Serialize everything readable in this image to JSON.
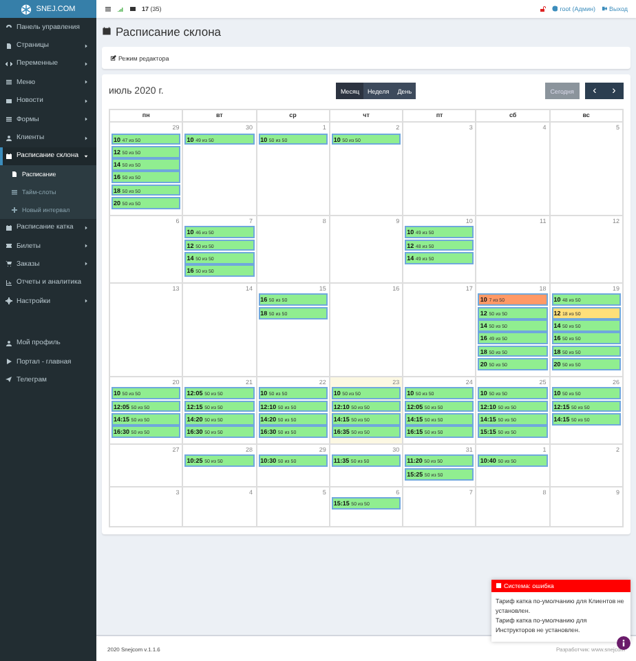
{
  "brand": "SNEJ.COM",
  "sidebar": {
    "items": [
      {
        "label": "Панель управления",
        "has_caret": false,
        "selected": false
      },
      {
        "label": "Страницы",
        "has_caret": true,
        "expanded": false,
        "selected": false
      },
      {
        "label": "Переменные",
        "has_caret": true,
        "expanded": false,
        "selected": false
      },
      {
        "label": "Меню",
        "has_caret": true,
        "expanded": false,
        "selected": false
      },
      {
        "label": "Новости",
        "has_caret": true,
        "expanded": false,
        "selected": false
      },
      {
        "label": "Формы",
        "has_caret": true,
        "expanded": false,
        "selected": false
      },
      {
        "label": "Клиенты",
        "has_caret": true,
        "expanded": false,
        "selected": false
      },
      {
        "label": "Расписание склона",
        "has_caret": true,
        "expanded": true,
        "selected": true,
        "children": [
          {
            "label": "Расписание",
            "selected": true
          },
          {
            "label": "Тайм-слоты",
            "selected": false
          },
          {
            "label": "Новый интервал",
            "selected": false
          }
        ]
      },
      {
        "label": "Расписание катка",
        "has_caret": true,
        "expanded": false,
        "selected": false
      },
      {
        "label": "Билеты",
        "has_caret": true,
        "expanded": false,
        "selected": false
      },
      {
        "label": "Заказы",
        "has_caret": true,
        "expanded": false,
        "selected": false
      },
      {
        "label": "Отчеты и аналитика",
        "has_caret": false,
        "selected": false
      },
      {
        "label": "Настройки",
        "has_caret": true,
        "expanded": false,
        "selected": false
      }
    ],
    "bottom_items": [
      "Мой профиль",
      "Портал - главная",
      "Телеграм"
    ]
  },
  "topbar": {
    "count": "17",
    "count_total": "(35)",
    "user": "root (Админ)",
    "logout": "Выход"
  },
  "page_title": "Расписание склона",
  "editor_mode": "Режим редактора",
  "calendar": {
    "title": "июль 2020 г.",
    "views": [
      {
        "label": "Месяц",
        "selected": true
      },
      {
        "label": "Неделя",
        "selected": false
      },
      {
        "label": "День",
        "selected": false
      }
    ],
    "today_button": {
      "label": "Сегодня",
      "disabled": true
    },
    "prev": "‹",
    "next": "›",
    "weekdays": [
      "пн",
      "вт",
      "ср",
      "чт",
      "пт",
      "сб",
      "вс"
    ],
    "weeks": [
      [
        {
          "day": "29",
          "today": false,
          "events": [
            {
              "time": "10",
              "text": "47 из 50",
              "color": "#90ee90"
            },
            {
              "time": "12",
              "text": "50 из 50",
              "color": "#90ee90"
            },
            {
              "time": "14",
              "text": "50 из 50",
              "color": "#90ee90"
            },
            {
              "time": "16",
              "text": "50 из 50",
              "color": "#90ee90"
            },
            {
              "time": "18",
              "text": "50 из 50",
              "color": "#90ee90"
            },
            {
              "time": "20",
              "text": "50 из 50",
              "color": "#90ee90"
            }
          ]
        },
        {
          "day": "30",
          "today": false,
          "events": [
            {
              "time": "10",
              "text": "49 из 50",
              "color": "#90ee90"
            }
          ]
        },
        {
          "day": "1",
          "today": false,
          "events": [
            {
              "time": "10",
              "text": "50 из 50",
              "color": "#90ee90"
            }
          ]
        },
        {
          "day": "2",
          "today": false,
          "events": [
            {
              "time": "10",
              "text": "50 из 50",
              "color": "#90ee90"
            }
          ]
        },
        {
          "day": "3",
          "today": false
        },
        {
          "day": "4",
          "today": false
        },
        {
          "day": "5",
          "today": false
        }
      ],
      [
        {
          "day": "6",
          "today": false
        },
        {
          "day": "7",
          "today": false,
          "events": [
            {
              "time": "10",
              "text": "46 из 50",
              "color": "#90ee90"
            },
            {
              "time": "12",
              "text": "50 из 50",
              "color": "#90ee90"
            },
            {
              "time": "14",
              "text": "50 из 50",
              "color": "#90ee90"
            },
            {
              "time": "16",
              "text": "50 из 50",
              "color": "#90ee90"
            }
          ]
        },
        {
          "day": "8",
          "today": false
        },
        {
          "day": "9",
          "today": false
        },
        {
          "day": "10",
          "today": false,
          "events": [
            {
              "time": "10",
              "text": "49 из 50",
              "color": "#90ee90"
            },
            {
              "time": "12",
              "text": "48 из 50",
              "color": "#90ee90"
            },
            {
              "time": "14",
              "text": "49 из 50",
              "color": "#90ee90"
            }
          ]
        },
        {
          "day": "11",
          "today": false
        },
        {
          "day": "12",
          "today": false
        }
      ],
      [
        {
          "day": "13",
          "today": false
        },
        {
          "day": "14",
          "today": false
        },
        {
          "day": "15",
          "today": false,
          "events": [
            {
              "time": "16",
              "text": "50 из 50",
              "color": "#90ee90"
            },
            {
              "time": "18",
              "text": "50 из 50",
              "color": "#90ee90"
            }
          ]
        },
        {
          "day": "16",
          "today": false
        },
        {
          "day": "17",
          "today": false
        },
        {
          "day": "18",
          "today": false,
          "events": [
            {
              "time": "10",
              "text": "7 из 50",
              "color": "#ff9966"
            },
            {
              "time": "12",
              "text": "50 из 50",
              "color": "#90ee90"
            },
            {
              "time": "14",
              "text": "50 из 50",
              "color": "#90ee90"
            },
            {
              "time": "16",
              "text": "49 из 50",
              "color": "#90ee90"
            },
            {
              "time": "18",
              "text": "50 из 50",
              "color": "#90ee90"
            },
            {
              "time": "20",
              "text": "50 из 50",
              "color": "#90ee90"
            }
          ]
        },
        {
          "day": "19",
          "today": false,
          "events": [
            {
              "time": "10",
              "text": "48 из 50",
              "color": "#90ee90"
            },
            {
              "time": "12",
              "text": "18 из 50",
              "color": "#ffe07a"
            },
            {
              "time": "14",
              "text": "50 из 50",
              "color": "#90ee90"
            },
            {
              "time": "16",
              "text": "50 из 50",
              "color": "#90ee90"
            },
            {
              "time": "18",
              "text": "50 из 50",
              "color": "#90ee90"
            },
            {
              "time": "20",
              "text": "50 из 50",
              "color": "#90ee90"
            }
          ]
        }
      ],
      [
        {
          "day": "20",
          "today": false,
          "events": [
            {
              "time": "10",
              "text": "50 из 50",
              "color": "#90ee90"
            },
            {
              "time": "12:05",
              "text": "50 из 50",
              "color": "#90ee90"
            },
            {
              "time": "14:15",
              "text": "50 из 50",
              "color": "#90ee90"
            },
            {
              "time": "16:30",
              "text": "50 из 50",
              "color": "#90ee90"
            }
          ]
        },
        {
          "day": "21",
          "today": false,
          "events": [
            {
              "time": "12:05",
              "text": "50 из 50",
              "color": "#90ee90"
            },
            {
              "time": "12:15",
              "text": "50 из 50",
              "color": "#90ee90"
            },
            {
              "time": "14:20",
              "text": "50 из 50",
              "color": "#90ee90"
            },
            {
              "time": "16:30",
              "text": "50 из 50",
              "color": "#90ee90"
            }
          ]
        },
        {
          "day": "22",
          "today": false,
          "events": [
            {
              "time": "10",
              "text": "50 из 50",
              "color": "#90ee90"
            },
            {
              "time": "12:10",
              "text": "50 из 50",
              "color": "#90ee90"
            },
            {
              "time": "14:20",
              "text": "50 из 50",
              "color": "#90ee90"
            },
            {
              "time": "16:30",
              "text": "50 из 50",
              "color": "#90ee90"
            }
          ]
        },
        {
          "day": "23",
          "today": true,
          "events": [
            {
              "time": "10",
              "text": "50 из 50",
              "color": "#90ee90"
            },
            {
              "time": "12:10",
              "text": "50 из 50",
              "color": "#90ee90"
            },
            {
              "time": "14:15",
              "text": "50 из 50",
              "color": "#90ee90"
            },
            {
              "time": "16:35",
              "text": "50 из 50",
              "color": "#90ee90"
            }
          ]
        },
        {
          "day": "24",
          "today": false,
          "events": [
            {
              "time": "10",
              "text": "50 из 50",
              "color": "#90ee90"
            },
            {
              "time": "12:05",
              "text": "50 из 50",
              "color": "#90ee90"
            },
            {
              "time": "14:15",
              "text": "50 из 50",
              "color": "#90ee90"
            },
            {
              "time": "16:15",
              "text": "50 из 50",
              "color": "#90ee90"
            }
          ]
        },
        {
          "day": "25",
          "today": false,
          "events": [
            {
              "time": "10",
              "text": "50 из 50",
              "color": "#90ee90"
            },
            {
              "time": "12:10",
              "text": "50 из 50",
              "color": "#90ee90"
            },
            {
              "time": "14:15",
              "text": "50 из 50",
              "color": "#90ee90"
            },
            {
              "time": "15:15",
              "text": "50 из 50",
              "color": "#90ee90"
            }
          ]
        },
        {
          "day": "26",
          "today": false,
          "events": [
            {
              "time": "10",
              "text": "50 из 50",
              "color": "#90ee90"
            },
            {
              "time": "12:15",
              "text": "50 из 50",
              "color": "#90ee90"
            },
            {
              "time": "14:15",
              "text": "50 из 50",
              "color": "#90ee90"
            }
          ]
        }
      ],
      [
        {
          "day": "27",
          "today": false
        },
        {
          "day": "28",
          "today": false,
          "events": [
            {
              "time": "10:25",
              "text": "50 из 50",
              "color": "#90ee90"
            }
          ]
        },
        {
          "day": "29",
          "today": false,
          "events": [
            {
              "time": "10:30",
              "text": "50 из 50",
              "color": "#90ee90"
            }
          ]
        },
        {
          "day": "30",
          "today": false,
          "events": [
            {
              "time": "11:35",
              "text": "50 из 50",
              "color": "#90ee90"
            }
          ]
        },
        {
          "day": "31",
          "today": false,
          "events": [
            {
              "time": "11:20",
              "text": "50 из 50",
              "color": "#90ee90"
            },
            {
              "time": "15:25",
              "text": "50 из 50",
              "color": "#90ee90"
            }
          ]
        },
        {
          "day": "1",
          "today": false,
          "events": [
            {
              "time": "10:40",
              "text": "50 из 50",
              "color": "#90ee90"
            }
          ]
        },
        {
          "day": "2",
          "today": false
        }
      ],
      [
        {
          "day": "3",
          "today": false
        },
        {
          "day": "4",
          "today": false
        },
        {
          "day": "5",
          "today": false
        },
        {
          "day": "6",
          "today": false,
          "events": [
            {
              "time": "15:15",
              "text": "50 из 50",
              "color": "#90ee90"
            }
          ]
        },
        {
          "day": "7",
          "today": false
        },
        {
          "day": "8",
          "today": false
        },
        {
          "day": "9",
          "today": false
        }
      ]
    ]
  },
  "footer": {
    "left": "2020 Snejcom v.1.1.6",
    "right": "Разработчик: www.snejcom"
  },
  "toast": {
    "title": "Система: ошибка",
    "messages": [
      "Тариф катка по-умолчанию для Клиентов не установлен.",
      "Тариф катка по-умолчанию для Инструкторов не установлен."
    ]
  }
}
